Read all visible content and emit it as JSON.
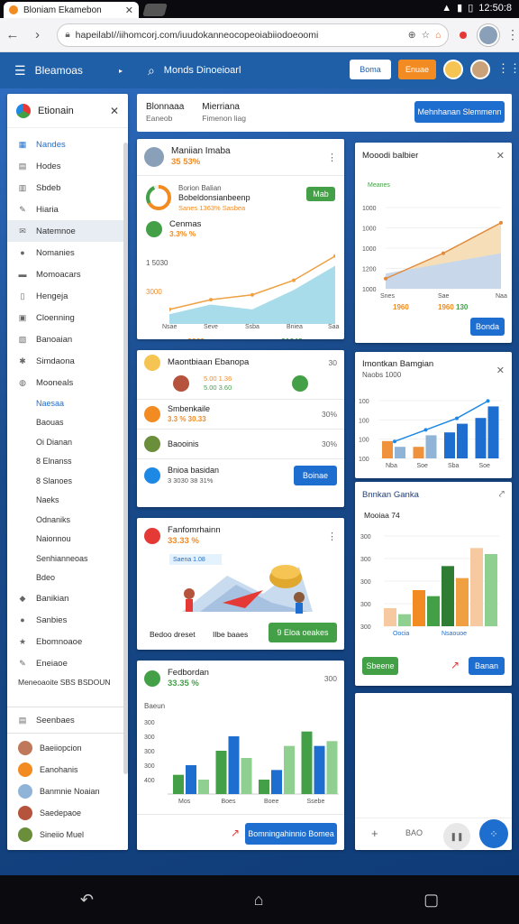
{
  "browser": {
    "tab_title": "Bloniam Ekamebon",
    "url": "hapeilabI//iihomcorj.com/iuudokanneocopeoiabiiodoeoomi",
    "status_time": "12:50:8"
  },
  "header": {
    "app_name": "Bleamoas",
    "search_text": "Monds Dinoeioarl",
    "btn_primary": "Boma",
    "btn_accent": "Enuae"
  },
  "sidebar": {
    "title": "Etionain",
    "items": [
      {
        "label": "Nandes",
        "icon": "dashboard-icon"
      },
      {
        "label": "Hodes",
        "icon": "chart-icon"
      },
      {
        "label": "Sbdeb",
        "icon": "grid-icon"
      },
      {
        "label": "Hiaria",
        "icon": "tools-icon"
      },
      {
        "label": "Natemnoe",
        "icon": "mail-icon"
      },
      {
        "label": "Nomanies",
        "icon": "user-icon"
      },
      {
        "label": "Momoacars",
        "icon": "folder-icon"
      },
      {
        "label": "Hengeja",
        "icon": "file-icon"
      },
      {
        "label": "Cloenning",
        "icon": "calendar-icon"
      },
      {
        "label": "Banoaian",
        "icon": "gift-icon"
      },
      {
        "label": "Simdaona",
        "icon": "settings-icon"
      },
      {
        "label": "Mooneals",
        "icon": "globe-icon"
      }
    ],
    "sub_items": [
      "Naesaa",
      "Baouas",
      "Oi Dianan",
      "8 Elnanss",
      "8 Slanoes",
      "Naeks",
      "Odnaniks",
      "Naionnou",
      "Senhianneoas",
      "Bdeo"
    ],
    "items2": [
      {
        "label": "Banikian",
        "icon": "layers-icon"
      },
      {
        "label": "Sanbies",
        "icon": "info-icon"
      },
      {
        "label": "Ebomnoaoe",
        "icon": "star-icon"
      },
      {
        "label": "Eneiaoe",
        "icon": "edit-icon"
      }
    ],
    "footer_text": "Meneoaoite SBS BSDOUN",
    "section": "Seenbaes",
    "users": [
      {
        "name": "Baeiiopcion",
        "color": "#c0785a"
      },
      {
        "name": "Eanohanis",
        "color": "#f28b22"
      },
      {
        "name": "Banmnie Noaian",
        "color": "#8fb4d8"
      },
      {
        "name": "Saedepaoe",
        "color": "#b5533c"
      },
      {
        "name": "Sineiio Muel",
        "color": "#6a8e3a"
      }
    ]
  },
  "strip": {
    "col1_title": "Blonnaaa",
    "col1_sub": "Eaneob",
    "col2_title": "Mierriana",
    "col2_sub": "Fimenon liag",
    "button": "Mehnhanan Slemmenn"
  },
  "card1": {
    "title": "Maniian Imaba",
    "pct": "35 53%",
    "row1_a": "Borion Balian",
    "row1_b": "Bobeldonsianbeenp",
    "row1_c": "Sanes 1363% Sasbea",
    "button": "Mab",
    "series_title": "Cenmas",
    "series_pct": "3.3% %",
    "y_label": "1 5030",
    "y_label2": "3000",
    "x_labels": [
      "Nsae",
      "Seve",
      "Ssba",
      "Bniea",
      "Saa"
    ],
    "foot1": "8363",
    "foot2": "31348"
  },
  "card2": {
    "title": "Maontbiaan Ebanopa",
    "right": "30",
    "r1_a": "5.00 1.36",
    "r1_b": "5.00 3.60",
    "row2_title": "Smbenkaile",
    "row2_pct": "3.3 % 30.33",
    "row2_right": "30%",
    "row3_title": "Baooinis",
    "row3_right": "30%",
    "row4_title": "Bnioa basidan",
    "row4_sub": "3 3030 38 31%",
    "button": "Boinae"
  },
  "card3": {
    "title": "Fanfomrhainn",
    "pct": "33.33 %",
    "tag": "Saena 1.08",
    "label_a": "Bedoo dreset",
    "label_b": "Ilbe baaes",
    "button": "9 Eloa oeakes"
  },
  "card4": {
    "title": "Fedbordan",
    "pct": "33.35 %",
    "right": "300",
    "ylab": "Baeun",
    "yticks": [
      "400",
      "300",
      "300",
      "300",
      "300"
    ],
    "xticks": [
      "Mos",
      "Boes",
      "Boee",
      "Ssebe"
    ],
    "button": "Bomningahinnio Bomea"
  },
  "card5": {
    "title": "Mooodi balbier",
    "legend": "Meanes",
    "yticks": [
      "1000",
      "1200",
      "1000",
      "1000",
      "1000"
    ],
    "xlab": [
      "Snes",
      "Sae",
      "Naa"
    ],
    "foot1": "1960",
    "foot2": "1960",
    "foot3": "130",
    "button": "Bonda"
  },
  "card6": {
    "title": "Imontkan Bamgian",
    "sub": "Naobs 1000",
    "yticks": [
      "100",
      "100",
      "100",
      "100"
    ],
    "xticks": [
      "Nba",
      "Soe",
      "Sba",
      "Soe"
    ]
  },
  "card7": {
    "title": "Bnnkan Ganka",
    "sub": "Mooiaa 74",
    "yticks": [
      "300",
      "300",
      "300",
      "300",
      "300"
    ],
    "xticks": [
      "Oocia",
      "Nsaouoe"
    ],
    "btn_green": "Sbeene",
    "btn_blue": "Banan"
  },
  "card8": {
    "zoom": "BAO"
  },
  "chart_data": [
    {
      "type": "area",
      "x": [
        "Nsae",
        "Seve",
        "Ssba",
        "Bniea",
        "Saa"
      ],
      "series": [
        {
          "values": [
            3,
            5,
            6,
            9,
            14
          ]
        },
        {
          "values": [
            2,
            4,
            3,
            7,
            12
          ]
        }
      ],
      "title": "Cenmas"
    },
    {
      "type": "bar",
      "categories": [
        "Mos",
        "Boes",
        "Boee",
        "Ssebe"
      ],
      "series": [
        {
          "values": [
            80,
            180,
            60,
            260
          ]
        },
        {
          "values": [
            120,
            240,
            100,
            200
          ]
        },
        {
          "values": [
            60,
            150,
            200,
            220
          ]
        }
      ],
      "title": "Fedbordan"
    },
    {
      "type": "area",
      "x": [
        "Snes",
        "Sae",
        "Naa"
      ],
      "series": [
        {
          "values": [
            1000,
            1250,
            1550
          ]
        },
        {
          "values": [
            1050,
            1150,
            1250
          ]
        }
      ],
      "title": "Mooodi balbier"
    },
    {
      "type": "bar",
      "categories": [
        "Nba",
        "Soe",
        "Sba",
        "Soe"
      ],
      "series": [
        {
          "values": [
            30,
            20,
            45,
            70
          ]
        },
        {
          "values": [
            20,
            40,
            60,
            90
          ]
        }
      ],
      "title": "Imontkan Bamgian"
    },
    {
      "type": "bar",
      "categories": [
        "Oocia",
        "Nsaouoe"
      ],
      "series": [
        {
          "values": [
            60,
            120,
            200,
            260
          ]
        },
        {
          "values": [
            40,
            100,
            160,
            240
          ]
        }
      ],
      "title": "Bnnkan Ganka"
    }
  ]
}
